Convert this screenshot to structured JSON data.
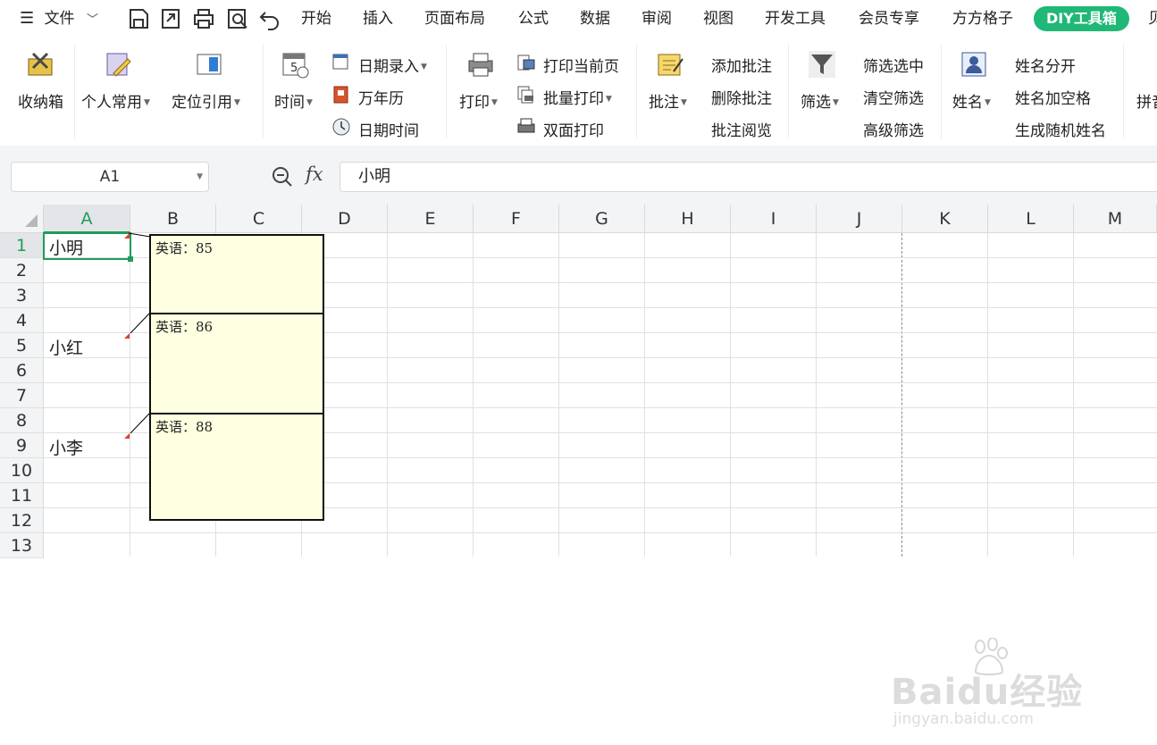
{
  "menubar": {
    "file_menu": "文件",
    "tabs": [
      "开始",
      "插入",
      "页面布局",
      "公式",
      "数据",
      "审阅",
      "视图",
      "开发工具",
      "会员专享",
      "方方格子"
    ],
    "active_tab": "DIY工具箱",
    "overflow_tab_fragment": "贝"
  },
  "ribbon": {
    "toolbox": "收纳箱",
    "personal": "个人常用",
    "locate_ref": "定位引用",
    "time": "时间",
    "date_entry": "日期录入",
    "calendar": "万年历",
    "date_time": "日期时间",
    "print": "打印",
    "print_current": "打印当前页",
    "batch_print": "批量打印",
    "duplex_print": "双面打印",
    "comment": "批注",
    "add_comment": "添加批注",
    "delete_comment": "删除批注",
    "view_comment": "批注阅览",
    "filter": "筛选",
    "filter_select": "筛选选中",
    "clear_filter": "清空筛选",
    "advanced_filter": "高级筛选",
    "name": "姓名",
    "split_name": "姓名分开",
    "name_space": "姓名加空格",
    "random_name": "生成随机姓名",
    "overflow_fragment": "拼音"
  },
  "formula_bar": {
    "cell_ref": "A1",
    "fx_label": "fx",
    "content": "小明"
  },
  "sheet": {
    "columns": [
      "A",
      "B",
      "C",
      "D",
      "E",
      "F",
      "G",
      "H",
      "I",
      "J",
      "K",
      "L",
      "M"
    ],
    "rows": [
      "1",
      "2",
      "3",
      "4",
      "5",
      "6",
      "7",
      "8",
      "9",
      "10",
      "11",
      "12",
      "13"
    ],
    "cells": {
      "A1": "小明",
      "A5": "小红",
      "A9": "小李"
    },
    "comments": [
      {
        "cell": "A1",
        "text": "英语：85"
      },
      {
        "cell": "A5",
        "text": "英语：86"
      },
      {
        "cell": "A9",
        "text": "英语：88"
      }
    ]
  },
  "watermark": {
    "brand": "Baidu经验",
    "url": "jingyan.baidu.com"
  }
}
